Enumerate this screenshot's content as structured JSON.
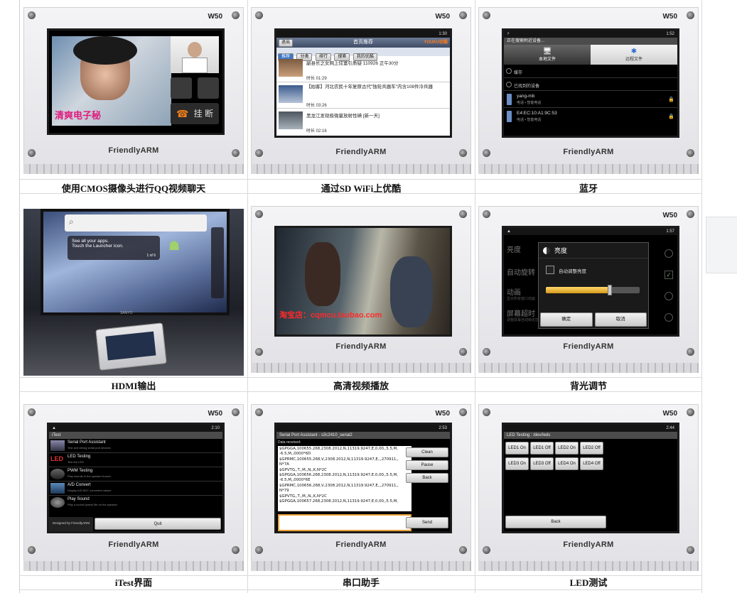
{
  "board_model": "W50",
  "board_brand": "FriendlyARM",
  "captions": {
    "cmos_qq": "使用CMOS摄像头进行QQ视频聊天",
    "sd_wifi_youku": "通过SD WiFi上优酷",
    "bluetooth": "蓝牙",
    "hdmi": "HDMI输出",
    "hd_video": "高清视频播放",
    "backlight": "背光调节",
    "itest": "iTest界面",
    "serial": "串口助手",
    "led": "LED测试"
  },
  "qq_screen": {
    "overlay_text": "清爽电子秘",
    "hangup_label": "挂 断"
  },
  "youku_screen": {
    "time": "1:30",
    "back_label": "退出",
    "title": "首页推荐",
    "logo": "YOUKU优酷",
    "tabs": [
      "推荐",
      "分类",
      "排行",
      "搜索",
      "我的优酷"
    ],
    "items": [
      {
        "title": "副县长之女网上炫富引质疑 110926 正午30分",
        "duration": "时长 01:29"
      },
      {
        "title": "【拍客】河北农民十年复原古代\"独轮兵器车\"内含108件冷兵器",
        "duration": "时长 03:26"
      },
      {
        "title": "黑龙江发现极微量放射性碘 [新一天]",
        "duration": "时长 02:16"
      }
    ]
  },
  "bt_screen": {
    "time": "1:52",
    "searching": "正在搜索附近设备...",
    "tab_local": "本地文件",
    "tab_remote": "远程文件",
    "cache": "缓存",
    "found": "已找到的设备",
    "devices": [
      {
        "name": "yang-mb",
        "sub": "电话 • 智能电话"
      },
      {
        "name": "E4:EC:10:A1:9C:53",
        "sub": "电话 • 智能电话"
      }
    ]
  },
  "hdmi_screen": {
    "hint_line1": "See all your apps.",
    "hint_line2": "Touch the Launcher icon.",
    "page": "1 of 6",
    "tv_brand": "SANYO"
  },
  "video_screen": {
    "watermark": "淘宝店：cqmcu.taobao.com"
  },
  "backlight_screen": {
    "time": "1:57",
    "dialog_title": "亮度",
    "auto_label": "自动调整亮度",
    "ok": "确定",
    "cancel": "取消",
    "brightness_level": 0.68,
    "bg_items": [
      {
        "label": "亮度"
      },
      {
        "label": "自动旋转"
      },
      {
        "label": "动画",
        "sub": "显示所有窗口动画"
      },
      {
        "label": "屏幕超时",
        "sub": "调整屏幕自动锁定前的延迟时间"
      }
    ]
  },
  "itest_screen": {
    "time": "2:10",
    "title": "iTest",
    "items": [
      {
        "label": "Serial Port Assistant",
        "sub": "Test and debug serial port devices"
      },
      {
        "label": "LED Testing",
        "sub": "Test the LED"
      },
      {
        "label": "PWM Testing",
        "sub": "Play sounds in the speaker buzzer"
      },
      {
        "label": "A/D Convert",
        "sub": "Display A/D ADC converted values"
      },
      {
        "label": "Play Sound",
        "sub": "Play a sound (wave) file on the speaker"
      }
    ],
    "footer_logo": "Designed by FriendlyARM",
    "quit": "Quit"
  },
  "serial_screen": {
    "time": "2:53",
    "title": "Serial Port Assistant - s3c2410_serial2",
    "data_received": "Data received:",
    "lines": [
      "$GPGGA,100655.268,2308.2012,N,11319.9247,E,0,00,,5.5,M,",
      "-6.5,M,,0000*6D",
      "$GPRMC,100655.268,V,2308.2012,N,11319.9247,E,,,270911,,",
      "N*7A",
      "$GPVTG,,T,,M,,N,,K,N*2C",
      "$GPGGA,100656.268,2308.2012,N,11319.9247,E,0,00,,5.5,M,",
      "-6.5,M,,0000*6E",
      "$GPRMC,100656.268,V,2308.2012,N,11319.9247,E,,,270911,,",
      "N*79",
      "$GPVTG,,T,,M,,N,,K,N*2C",
      "$GPGGA,100657.268,2308.2012,N,11319.9247,E,0,00,,5.5,M,"
    ],
    "clean": "Clean",
    "pause": "Pause",
    "back": "Back",
    "send": "Send"
  },
  "led_screen": {
    "time": "2:44",
    "title": "LED Testing : /dev/leds",
    "row1": [
      "LED1 On",
      "LED1 Off",
      "LED2 On",
      "LED2 Off"
    ],
    "row2": [
      "LED3 On",
      "LED3 Off",
      "LED4 On",
      "LED4 Off"
    ],
    "back": "Back"
  }
}
